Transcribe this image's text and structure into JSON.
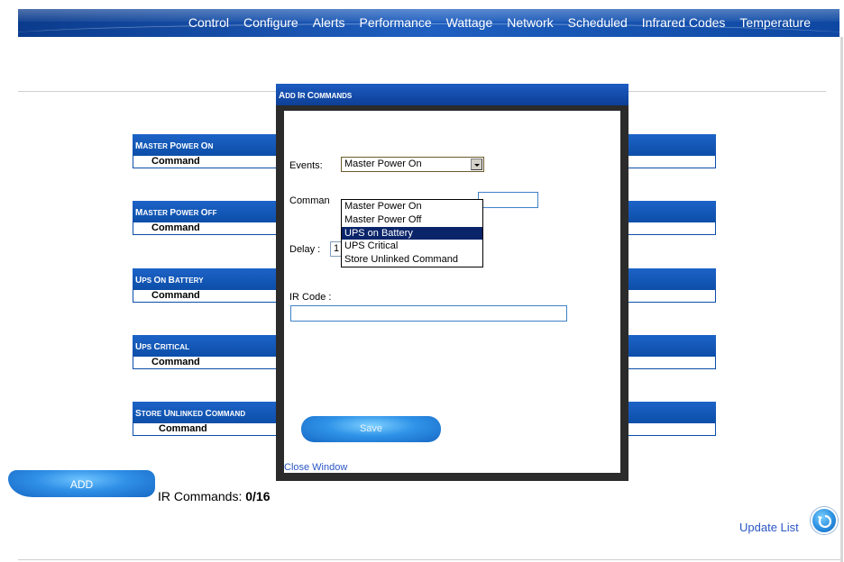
{
  "nav": {
    "items": [
      "Control",
      "Configure",
      "Alerts",
      "Performance",
      "Wattage",
      "Network",
      "Scheduled",
      "Infrared Codes",
      "Temperature"
    ]
  },
  "events": [
    {
      "title": "Master Power On",
      "column": "Command"
    },
    {
      "title": "Master Power Off",
      "column": "Command"
    },
    {
      "title": "UPS On Battery",
      "column": "Command"
    },
    {
      "title": "UPS Critical",
      "column": "Command"
    },
    {
      "title": "Store Unlinked Command",
      "column": "Command"
    }
  ],
  "footer": {
    "add_label": "ADD",
    "ir_count_label": "IR Commands:",
    "ir_count_value": "0/16",
    "update_label": "Update List"
  },
  "modal": {
    "title": "Add IR Commands",
    "events_label": "Events:",
    "events_selected": "Master Power On",
    "events_options": [
      "Master Power On",
      "Master Power Off",
      "UPS on Battery",
      "UPS Critical",
      "Store Unlinked Command"
    ],
    "events_highlighted": "UPS on Battery",
    "command_label": "Comman",
    "delay_label": "Delay :",
    "delay_value": "1 second",
    "ircode_label": "IR Code :",
    "save_label": "Save",
    "close_label": "Close Window"
  },
  "colors": {
    "nav_blue": "#1f5fc0",
    "header_blue": "#0c4ea8",
    "highlight": "#0a246a",
    "link": "#2a56c4"
  }
}
